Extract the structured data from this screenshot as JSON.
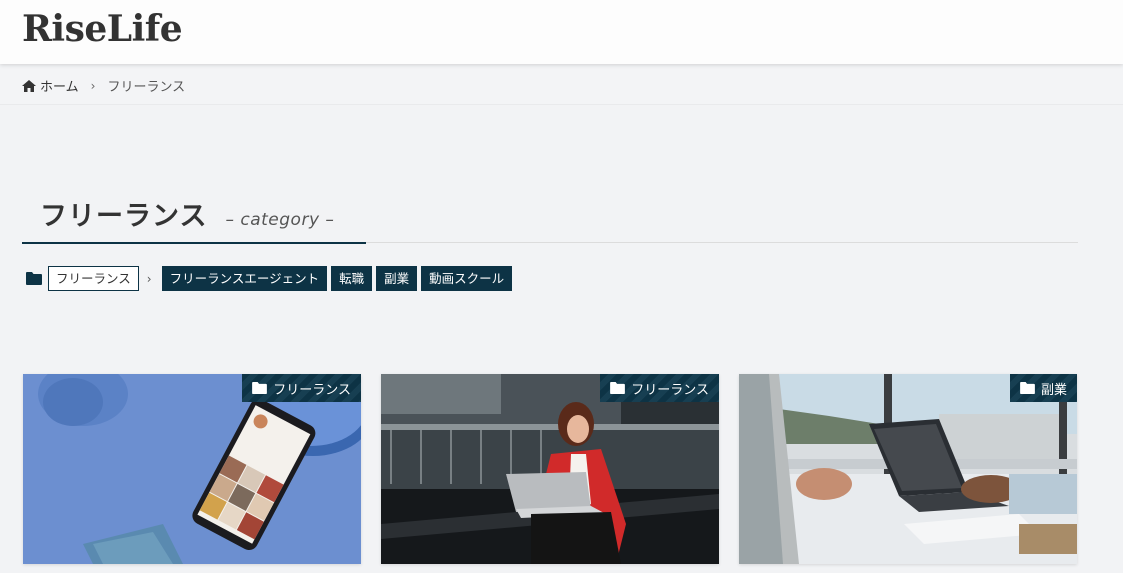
{
  "site": {
    "logo": "RiseLife"
  },
  "breadcrumb": {
    "home_label": "ホーム",
    "current": "フリーランス"
  },
  "page": {
    "title": "フリーランス",
    "subtitle": "– category –"
  },
  "categories": {
    "current": "フリーランス",
    "children": [
      "フリーランスエージェント",
      "転職",
      "副業",
      "動画スクール"
    ]
  },
  "cards": [
    {
      "category": "フリーランス",
      "image_icon": "smartphone-photo"
    },
    {
      "category": "フリーランス",
      "image_icon": "woman-laptop-photo"
    },
    {
      "category": "副業",
      "image_icon": "business-laptop-photo"
    }
  ],
  "colors": {
    "accent": "#0d3345",
    "background": "#f2f3f5"
  }
}
